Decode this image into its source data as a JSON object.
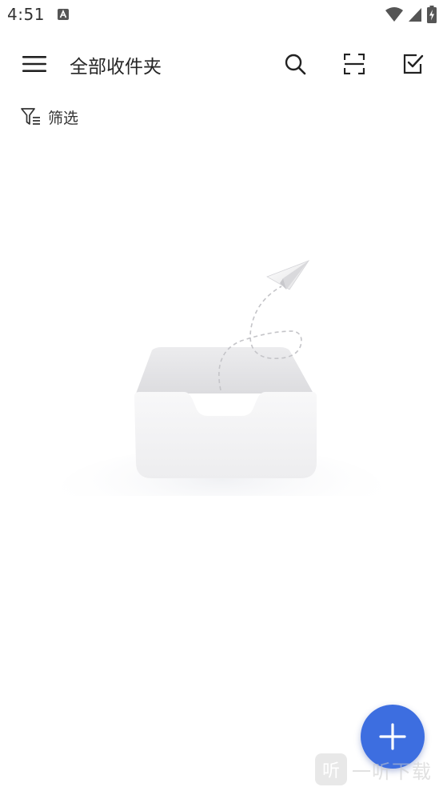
{
  "status_bar": {
    "time": "4:51",
    "icons": [
      "a-notification-icon",
      "wifi-icon",
      "cell-signal-icon",
      "battery-charging-icon"
    ]
  },
  "app_bar": {
    "title": "全部收件夹",
    "menu_icon": "hamburger-menu-icon",
    "actions": [
      "search-icon",
      "scan-icon",
      "checkbox-select-icon"
    ]
  },
  "filter": {
    "label": "筛选",
    "icon": "filter-icon"
  },
  "empty_state": {
    "illustration": "empty-inbox-tray-with-paper-plane"
  },
  "fab": {
    "icon": "plus-icon"
  },
  "watermark": {
    "logo_char": "听",
    "text": "一听下载"
  },
  "colors": {
    "accent": "#3d6ee0",
    "text_primary": "#262626",
    "background": "#ffffff"
  }
}
